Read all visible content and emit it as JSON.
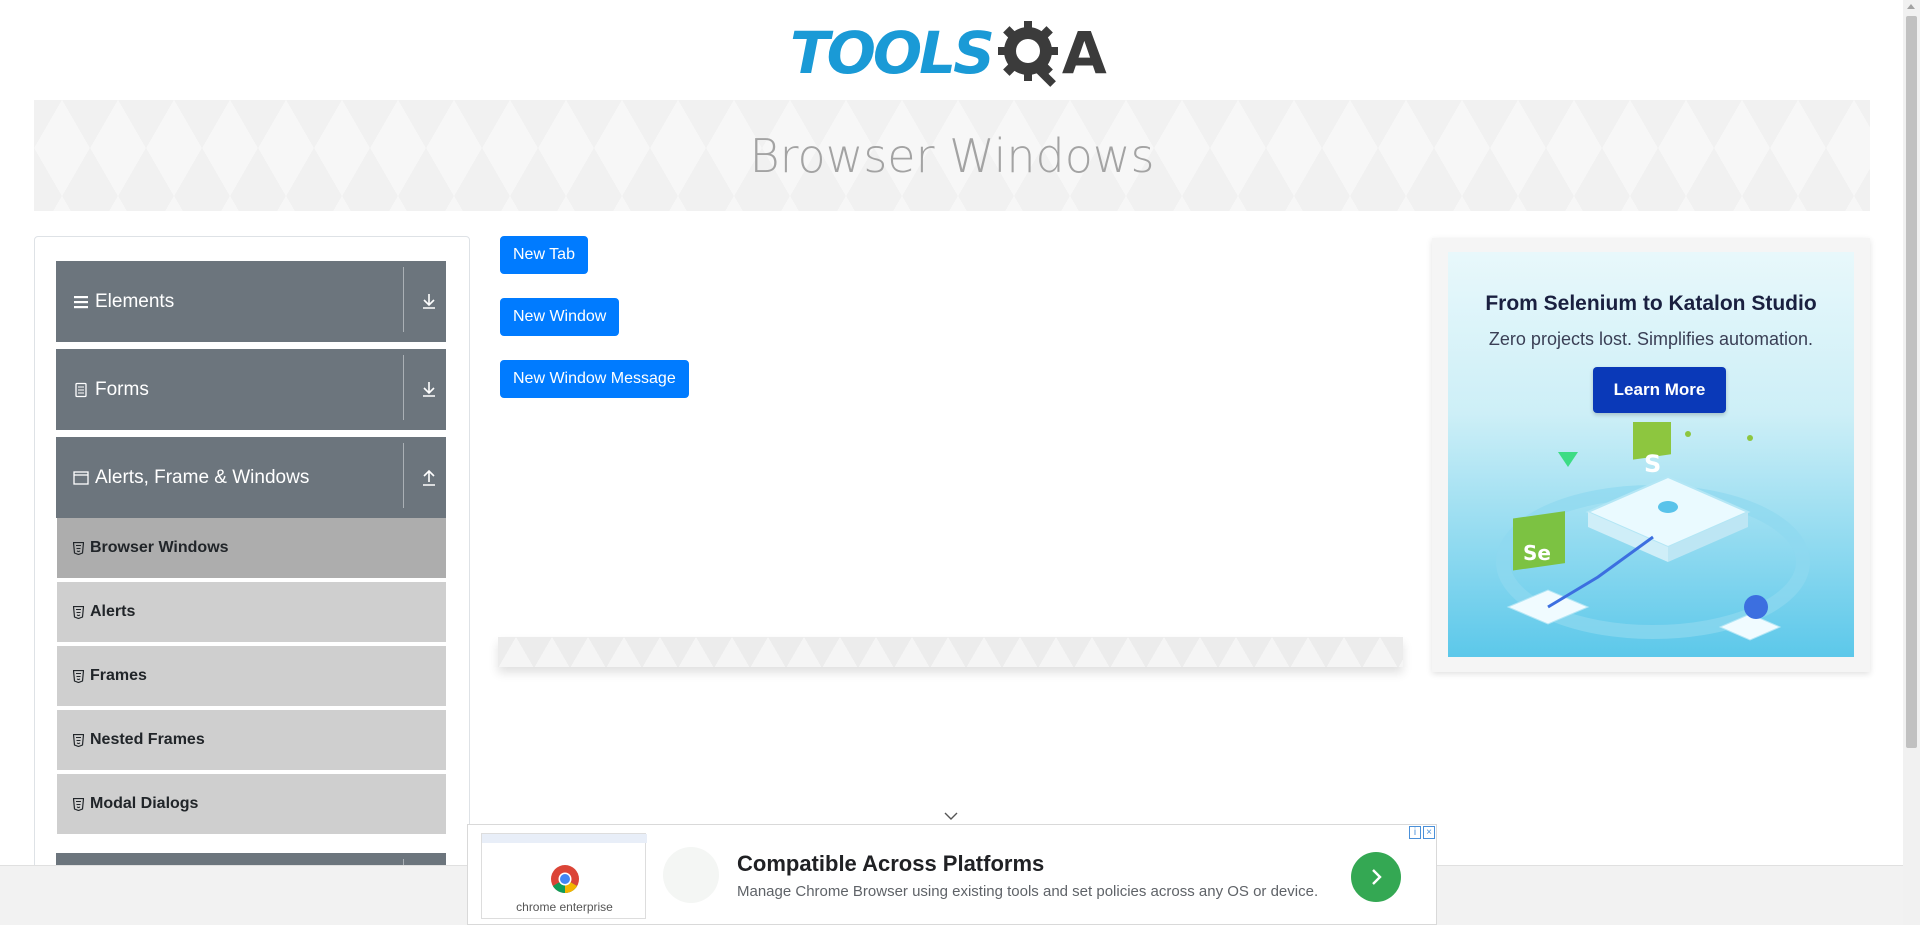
{
  "header": {
    "logo_tools": "TOOLS",
    "logo_qa_a": "A"
  },
  "banner": {
    "title": "Browser Windows"
  },
  "sidebar": {
    "groups": [
      {
        "label": "Elements",
        "icon": "menu-icon",
        "expanded": false
      },
      {
        "label": "Forms",
        "icon": "document-icon",
        "expanded": false
      },
      {
        "label": "Alerts, Frame & Windows",
        "icon": "window-icon",
        "expanded": true
      }
    ],
    "items": [
      {
        "label": "Browser Windows",
        "active": true
      },
      {
        "label": "Alerts",
        "active": false
      },
      {
        "label": "Frames",
        "active": false
      },
      {
        "label": "Nested Frames",
        "active": false
      },
      {
        "label": "Modal Dialogs",
        "active": false
      }
    ]
  },
  "main": {
    "buttons": {
      "new_tab": "New Tab",
      "new_window": "New Window",
      "new_window_message": "New Window Message"
    }
  },
  "ad_right": {
    "title": "From Selenium to Katalon Studio",
    "subtitle": "Zero projects lost. Simplifies automation.",
    "cta": "Learn More",
    "art_label_s": "S",
    "art_label_se": "Se"
  },
  "ad_bottom": {
    "thumb_text": "chrome enterprise",
    "title": "Compatible Across Platforms",
    "description": "Manage Chrome Browser using existing tools and set policies across any OS or device."
  },
  "colors": {
    "primary": "#007bff",
    "sidebar_group": "#6c757d",
    "sidebar_item": "#cfcfcf",
    "sidebar_item_active": "#adadad",
    "logo_blue": "#1a9ad6"
  }
}
